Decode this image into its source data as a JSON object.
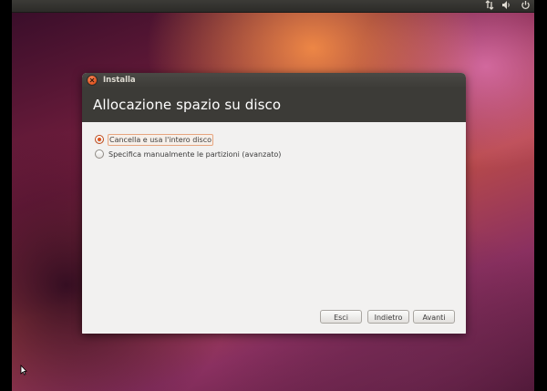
{
  "panel": {
    "network_icon": "network-arrows-icon",
    "volume_icon": "speaker-icon",
    "power_icon": "power-icon"
  },
  "window": {
    "title": "Installa",
    "page_title": "Allocazione spazio su disco",
    "options": [
      {
        "label": "Cancella e usa l'intero disco",
        "selected": true
      },
      {
        "label": "Specifica manualmente le partizioni (avanzato)",
        "selected": false
      }
    ],
    "buttons": {
      "quit": "Esci",
      "back": "Indietro",
      "next": "Avanti"
    }
  },
  "colors": {
    "accent": "#e0531e",
    "titlebar": "#3c3b37",
    "window_bg": "#f2f1f0"
  }
}
